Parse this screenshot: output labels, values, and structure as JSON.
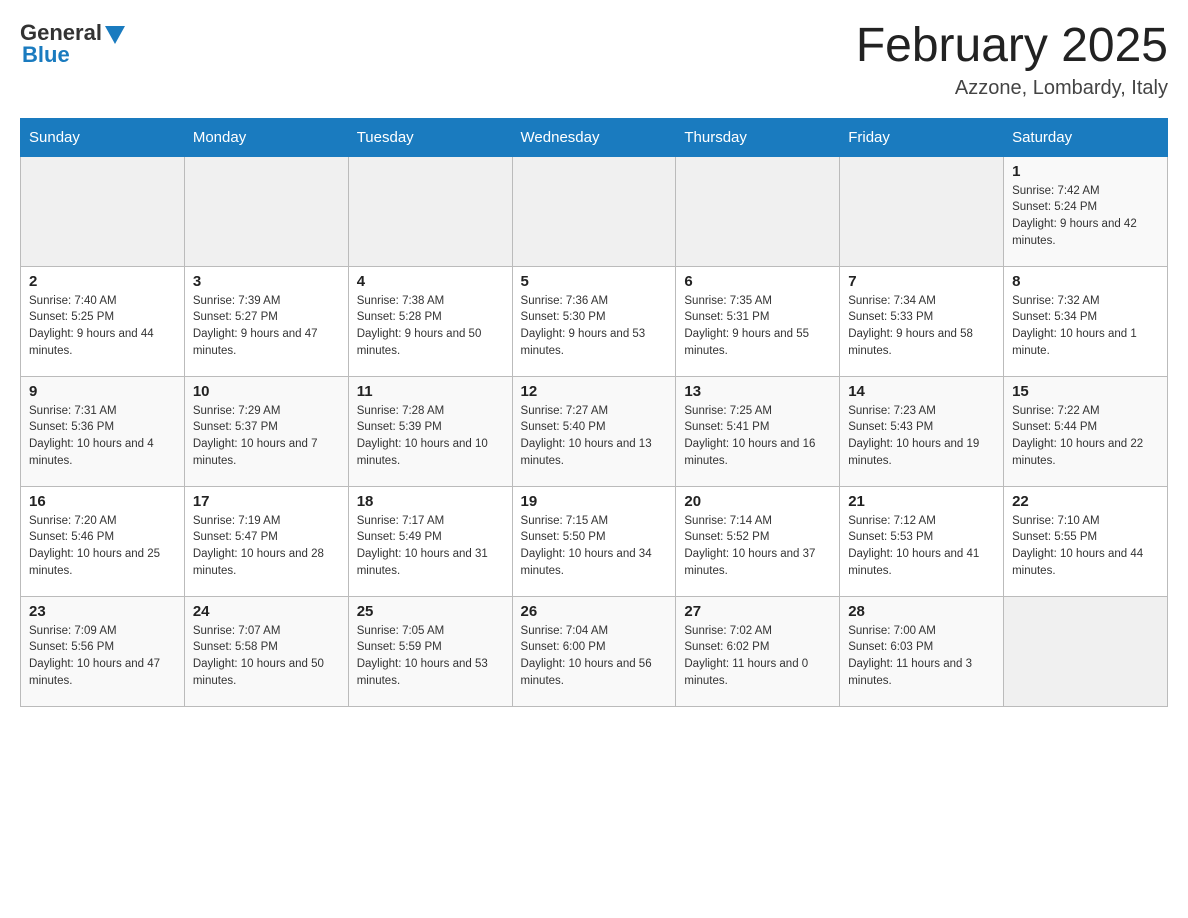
{
  "header": {
    "logo": {
      "general_text": "General",
      "blue_text": "Blue"
    },
    "title": "February 2025",
    "location": "Azzone, Lombardy, Italy"
  },
  "weekdays": [
    "Sunday",
    "Monday",
    "Tuesday",
    "Wednesday",
    "Thursday",
    "Friday",
    "Saturday"
  ],
  "weeks": [
    [
      {
        "day": "",
        "info": ""
      },
      {
        "day": "",
        "info": ""
      },
      {
        "day": "",
        "info": ""
      },
      {
        "day": "",
        "info": ""
      },
      {
        "day": "",
        "info": ""
      },
      {
        "day": "",
        "info": ""
      },
      {
        "day": "1",
        "info": "Sunrise: 7:42 AM\nSunset: 5:24 PM\nDaylight: 9 hours and 42 minutes."
      }
    ],
    [
      {
        "day": "2",
        "info": "Sunrise: 7:40 AM\nSunset: 5:25 PM\nDaylight: 9 hours and 44 minutes."
      },
      {
        "day": "3",
        "info": "Sunrise: 7:39 AM\nSunset: 5:27 PM\nDaylight: 9 hours and 47 minutes."
      },
      {
        "day": "4",
        "info": "Sunrise: 7:38 AM\nSunset: 5:28 PM\nDaylight: 9 hours and 50 minutes."
      },
      {
        "day": "5",
        "info": "Sunrise: 7:36 AM\nSunset: 5:30 PM\nDaylight: 9 hours and 53 minutes."
      },
      {
        "day": "6",
        "info": "Sunrise: 7:35 AM\nSunset: 5:31 PM\nDaylight: 9 hours and 55 minutes."
      },
      {
        "day": "7",
        "info": "Sunrise: 7:34 AM\nSunset: 5:33 PM\nDaylight: 9 hours and 58 minutes."
      },
      {
        "day": "8",
        "info": "Sunrise: 7:32 AM\nSunset: 5:34 PM\nDaylight: 10 hours and 1 minute."
      }
    ],
    [
      {
        "day": "9",
        "info": "Sunrise: 7:31 AM\nSunset: 5:36 PM\nDaylight: 10 hours and 4 minutes."
      },
      {
        "day": "10",
        "info": "Sunrise: 7:29 AM\nSunset: 5:37 PM\nDaylight: 10 hours and 7 minutes."
      },
      {
        "day": "11",
        "info": "Sunrise: 7:28 AM\nSunset: 5:39 PM\nDaylight: 10 hours and 10 minutes."
      },
      {
        "day": "12",
        "info": "Sunrise: 7:27 AM\nSunset: 5:40 PM\nDaylight: 10 hours and 13 minutes."
      },
      {
        "day": "13",
        "info": "Sunrise: 7:25 AM\nSunset: 5:41 PM\nDaylight: 10 hours and 16 minutes."
      },
      {
        "day": "14",
        "info": "Sunrise: 7:23 AM\nSunset: 5:43 PM\nDaylight: 10 hours and 19 minutes."
      },
      {
        "day": "15",
        "info": "Sunrise: 7:22 AM\nSunset: 5:44 PM\nDaylight: 10 hours and 22 minutes."
      }
    ],
    [
      {
        "day": "16",
        "info": "Sunrise: 7:20 AM\nSunset: 5:46 PM\nDaylight: 10 hours and 25 minutes."
      },
      {
        "day": "17",
        "info": "Sunrise: 7:19 AM\nSunset: 5:47 PM\nDaylight: 10 hours and 28 minutes."
      },
      {
        "day": "18",
        "info": "Sunrise: 7:17 AM\nSunset: 5:49 PM\nDaylight: 10 hours and 31 minutes."
      },
      {
        "day": "19",
        "info": "Sunrise: 7:15 AM\nSunset: 5:50 PM\nDaylight: 10 hours and 34 minutes."
      },
      {
        "day": "20",
        "info": "Sunrise: 7:14 AM\nSunset: 5:52 PM\nDaylight: 10 hours and 37 minutes."
      },
      {
        "day": "21",
        "info": "Sunrise: 7:12 AM\nSunset: 5:53 PM\nDaylight: 10 hours and 41 minutes."
      },
      {
        "day": "22",
        "info": "Sunrise: 7:10 AM\nSunset: 5:55 PM\nDaylight: 10 hours and 44 minutes."
      }
    ],
    [
      {
        "day": "23",
        "info": "Sunrise: 7:09 AM\nSunset: 5:56 PM\nDaylight: 10 hours and 47 minutes."
      },
      {
        "day": "24",
        "info": "Sunrise: 7:07 AM\nSunset: 5:58 PM\nDaylight: 10 hours and 50 minutes."
      },
      {
        "day": "25",
        "info": "Sunrise: 7:05 AM\nSunset: 5:59 PM\nDaylight: 10 hours and 53 minutes."
      },
      {
        "day": "26",
        "info": "Sunrise: 7:04 AM\nSunset: 6:00 PM\nDaylight: 10 hours and 56 minutes."
      },
      {
        "day": "27",
        "info": "Sunrise: 7:02 AM\nSunset: 6:02 PM\nDaylight: 11 hours and 0 minutes."
      },
      {
        "day": "28",
        "info": "Sunrise: 7:00 AM\nSunset: 6:03 PM\nDaylight: 11 hours and 3 minutes."
      },
      {
        "day": "",
        "info": ""
      }
    ]
  ]
}
